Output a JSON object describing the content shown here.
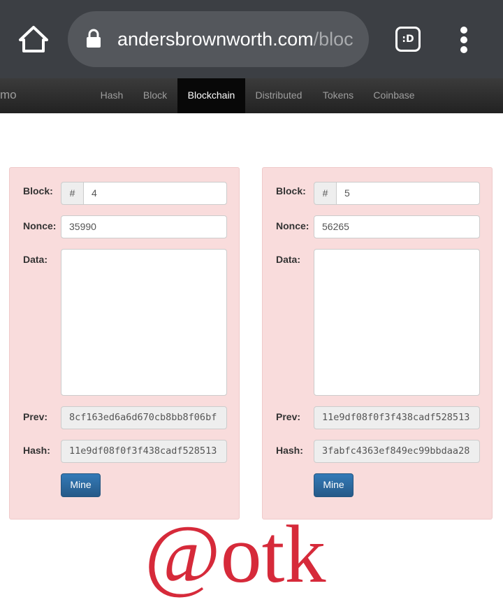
{
  "browser": {
    "url_host": "andersbrownworth.com",
    "url_path": "/bloc",
    "tabs_label": ":D",
    "icons": {
      "home": "home-icon",
      "lock": "lock-icon",
      "tabs": "tab-switcher-icon",
      "menu": "more-vert-icon"
    }
  },
  "site_nav": {
    "brand": "mo",
    "items": [
      {
        "label": "Hash",
        "active": false
      },
      {
        "label": "Block",
        "active": false
      },
      {
        "label": "Blockchain",
        "active": true
      },
      {
        "label": "Distributed",
        "active": false
      },
      {
        "label": "Tokens",
        "active": false
      },
      {
        "label": "Coinbase",
        "active": false
      }
    ]
  },
  "labels": {
    "block": "Block:",
    "nonce": "Nonce:",
    "data": "Data:",
    "prev": "Prev:",
    "hash": "Hash:",
    "mine": "Mine",
    "hash_addon": "#"
  },
  "blocks": [
    {
      "number": "4",
      "nonce": "35990",
      "data": "",
      "prev": "8cf163ed6a6d670cb8bb8f06bf",
      "hash": "11e9df08f0f3f438cadf528513"
    },
    {
      "number": "5",
      "nonce": "56265",
      "data": "",
      "prev": "11e9df08f0f3f438cadf528513",
      "hash": "3fabfc4363ef849ec99bbdaa28"
    }
  ],
  "watermark": "@otk",
  "colors": {
    "card_bg": "#f9dcdc",
    "mine_button": "#337ab7",
    "watermark": "#d62a3a",
    "nav_active": "#080808"
  }
}
